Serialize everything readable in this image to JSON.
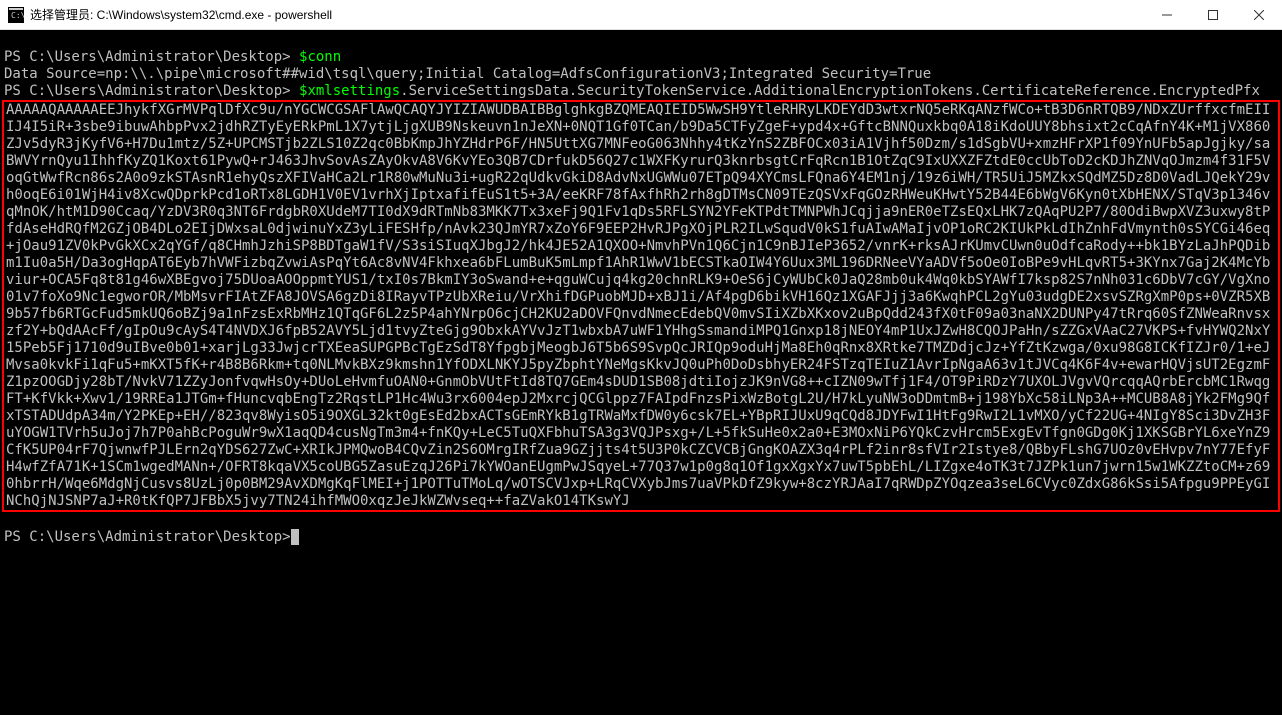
{
  "window": {
    "title": "选择管理员: C:\\Windows\\system32\\cmd.exe - powershell"
  },
  "terminal": {
    "line1_prompt": "PS C:\\Users\\Administrator\\Desktop> ",
    "line1_cmd": "$conn",
    "line2": "Data Source=np:\\\\.\\pipe\\microsoft##wid\\tsql\\query;Initial Catalog=AdfsConfigurationV3;Integrated Security=True",
    "line3_prompt": "PS C:\\Users\\Administrator\\Desktop> ",
    "line3_cmd": "$xmlsettings",
    "line3_prop": ".ServiceSettingsData.SecurityTokenService.AdditionalEncryptionTokens.CertificateReference.EncryptedPfx",
    "blob": "AAAAAQAAAAAEEJhykfXGrMVPqlDfXc9u/nYGCWCGSAFlAwQCAQYJYIZIAWUDBAIBBglghkgBZQMEAQIEID5WwSH9YtleRHRyLKDEYdD3wtxrNQ5eRKqANzfWCo+tB3D6nRTQB9/NDxZUrffxcfmEIIIJ4I5iR+3sbe9ibuwAhbpPvx2jdhRZTyEyERkPmL1X7ytjLjgXUB9Nskeuvn1nJeXN+0NQT1Gf0TCan/b9Da5CTFyZgeF+ypd4x+GftcBNNQuxkbq0A18iKdoUUY8bhsixt2cCqAfnY4K+M1jVX860ZJv5dyR3jKyfV6+H7Du1mtz/5Z+UPCMSTjb2ZLS10Z2qc0BbKmpJhYZHdrP6F/HN5UttXG7MNFeoG063Nhhy4tKzYnS2ZBFOCx03iA1Vjhf50Dzm/s1dSgbVU+xmzHFrXP1f09YnUFb5apJgjky/saBWVYrnQyu1IhhfKyZQ1Koxt61PywQ+rJ463JhvSovAsZAyOkvA8V6KvYEo3QB7CDrfukD56Q27c1WXFKyrurQ3knrbsgtCrFqRcn1B1OtZqC9IxUXXZFZtdE0ccUbToD2cKDJhZNVqOJmzm4f31F5VoqGtWwfRcn86s2A0o9zkSTAsnR1ehyQszXFIVaHCa2Lr1R80wMuNu3i+ugR22qUdkvGkiD8AdvNxUGWWu07ETpQ94XYCmsLFQna6Y4EM1nj/19z6iWH/TR5UiJ5MZkxSQdMZ5Dz8D0VadLJQekY29vh0oqE6i01WjH4iv8XcwQDprkPcd1oRTx8LGDH1V0EV1vrhXjIptxafifEuS1t5+3A/eeKRF78fAxfhRh2rh8gDTMsCN09TEzQSVxFqGOzRHWeuKHwtY52B44E6bWgV6Kyn0tXbHENX/STqV3p1346vqMnOK/htM1D90Ccaq/YzDV3R0q3NT6FrdgbR0XUdeM7TI0dX9dRTmNb83MKK7Tx3xeFj9Q1Fv1qDs5RFLSYN2YFeKTPdtTMNPWhJCqjja9nER0eTZsEQxLHK7zQAqPU2P7/80OdiBwpXVZ3uxwy8tPfdAseHdRQfM2GZjOB4DLo2EIjDWxsaL0djwinuYxZ3yLiFESHfp/nAvk23QJmYR7xZoY6F9EEP2HvRJPgXOjPLR2ILwSqudV0kS1fuAIwAMaIjvOP1oRC2KIUkPkLdIhZnhFdVmynth0sSYCGi46eq+jOau91ZV0kPvGkXCx2qYGf/q8CHmhJzhiSP8BDTgaW1fV/S3siSIuqXJbgJ2/hk4JE52A1QXOO+NmvhPVn1Q6Cjn1C9nBJIeP3652/vnrK+rksAJrKUmvCUwn0uOdfcaRody++bk1BYzLaJhPQDibm1Iu0a5H/Da3ogHqpAT6Eyb7hVWFizbqZvwiAsPqYt6Ac8vNV4Fkhxea6bFLumBuK5mLmpf1AhR1WwV1bECSTkaOIW4Y6Uux3ML196DRNeeVYaADVf5oOe0IoBPe9vHLqvRT5+3KYnx7Gaj2K4McYbviur+OCA5Fq8t81g46wXBEgvoj75DUoaAOOppmtYUS1/txI0s7BkmIY3oSwand+e+qguWCujq4kg20chnRLK9+OeS6jCyWUbCk0JaQ28mb0uk4Wq0kbSYAWfI7ksp82S7nNh031c6DbV7cGY/VgXno01v7foXo9Nc1egworOR/MbMsvrFIAtZFA8JOVSA6gzDi8IRayvTPzUbXReiu/VrXhifDGPuobMJD+xBJ1i/Af4pgD6bikVH16Qz1XGAFJjj3a6KwqhPCL2gYu03udgDE2xsvSZRgXmP0ps+0VZR5XB9b57fb6RTGcFud5mkUQ6oBZj9a1nFzsExRbMHz1QTqGF6L2z5P4ahYNrpO6cjCH2KU2aDOVFQnvdNmecEdebQV0mvSIiXZbXKxov2uBpQdd243fX0tF09a03naNX2DUNPy47tRrq60SfZNWeaRnvsxzf2Y+bQdAAcFf/gIpOu9cAyS4T4NVDXJ6fpB52AVY5Ljd1tvyZteGjg9ObxkAYVvJzT1wbxbA7uWF1YHhgSsmandiMPQ1Gnxp18jNEOY4mP1UxJZwH8CQOJPaHn/sZZGxVAaC27VKPS+fvHYWQ2NxY15Peb5Fj1710d9uIBve0b01+xarjLg33JwjcrTXEeaSUPGPBcTgEzSdT8YfpgbjMeogbJ6T5b6S9SvpQcJRIQp9oduHjMa8Eh0qRnx8XRtke7TMZDdjcJz+YfZtKzwga/0xu98G8ICKfIZJr0/1+eJMvsa0kvkFi1qFu5+mKXT5fK+r4B8B6Rkm+tq0NLMvkBXz9kmshn1YfODXLNKYJ5pyZbphtYNeMgsKkvJQ0uPh0DoDsbhyER24FSTzqTEIuZ1AvrIpNgaA63v1tJVCq4K6F4v+ewarHQVjsUT2EgzmFZ1pzOOGDjy28bT/NvkV71ZZyJonfvqwHsOy+DUoLeHvmfuOAN0+GnmObVUtFtId8TQ7GEm4sDUD1SB08jdtiIojzJK9nVG8++cIZN09wTfj1F4/OT9PiRDzY7UXOLJVgvVQrcqqAQrbErcbMC1RwqgFT+KfVkk+Xwv1/19RREa1JTGm+fHuncvqbEngTz2RqstLP1Hc4Wu3rx6004epJ2MxrcjQCGlppz7FAIpdFnzsPixWzBotgL2U/H7kLyuNW3oDDmtmB+j198YbXc58iLNp3A++MCUB8A8jYk2FMg9QfxTSTADUdpA34m/Y2PKEp+EH//823qv8WyisO5i9OXGL32kt0gEsEd2bxACTsGEmRYkB1gTRWaMxfDW0y6csk7EL+YBpRIJUxU9qCQd8JDYFwI1HtFg9RwI2L1vMXO/yCf22UG+4NIgY8Sci3DvZH3FuYOGW1TVrh5uJoj7h7P0ahBcPoguWr9wX1aqQD4cusNgTm3m4+fnKQy+LeC5TuQXFbhuTSA3g3VQJPsxg+/L+5fkSuHe0x2a0+E3MOxNiP6YQkCzvHrcm5ExgEvTfgn0GDg0Kj1XKSGBrYL6xeYnZ9CfK5UP04rF7QjwnwfPJLErn2qYDS627ZwC+XRIkJPMQwoB4CQvZin2S6OMrgIRfZua9GZjjts4t5U3P0kCZCVCBjGngKOAZX3q4rPLf2inr8sfVIr2Istye8/QBbyFLshG7UOz0vEHvpv7nY77EfyFH4wfZfA71K+1SCm1wgedMANn+/OFRT8kqaVX5coUBG5ZasuEzqJ26Pi7kYWOanEUgmPwJSqyeL+77Q37w1p0g8q1Of1gxXgxYx7uwT5pbEhL/LIZgxe4oTK3t7JZPk1un7jwrn15w1WKZZtoCM+z690hbrrH/Wqe6MdgNjCusvs8UzLj0p0BM29AvXDMgKqFlMEI+j1POTTuTMoLq/wOTSCVJxp+LRqCVXybJms7uaVPkDfZ9kyw+8czYRJAaI7qRWDpZYOqzea3seL6CVyc0ZdxG86kSsi5Afpgu9PPEyGINChQjNJSNP7aJ+R0tKfQP7JFBbX5jvy7TN24ihfMWO0xqzJeJkWZWvseq++faZVakO14TKswYJ",
    "final_prompt": "PS C:\\Users\\Administrator\\Desktop>"
  }
}
